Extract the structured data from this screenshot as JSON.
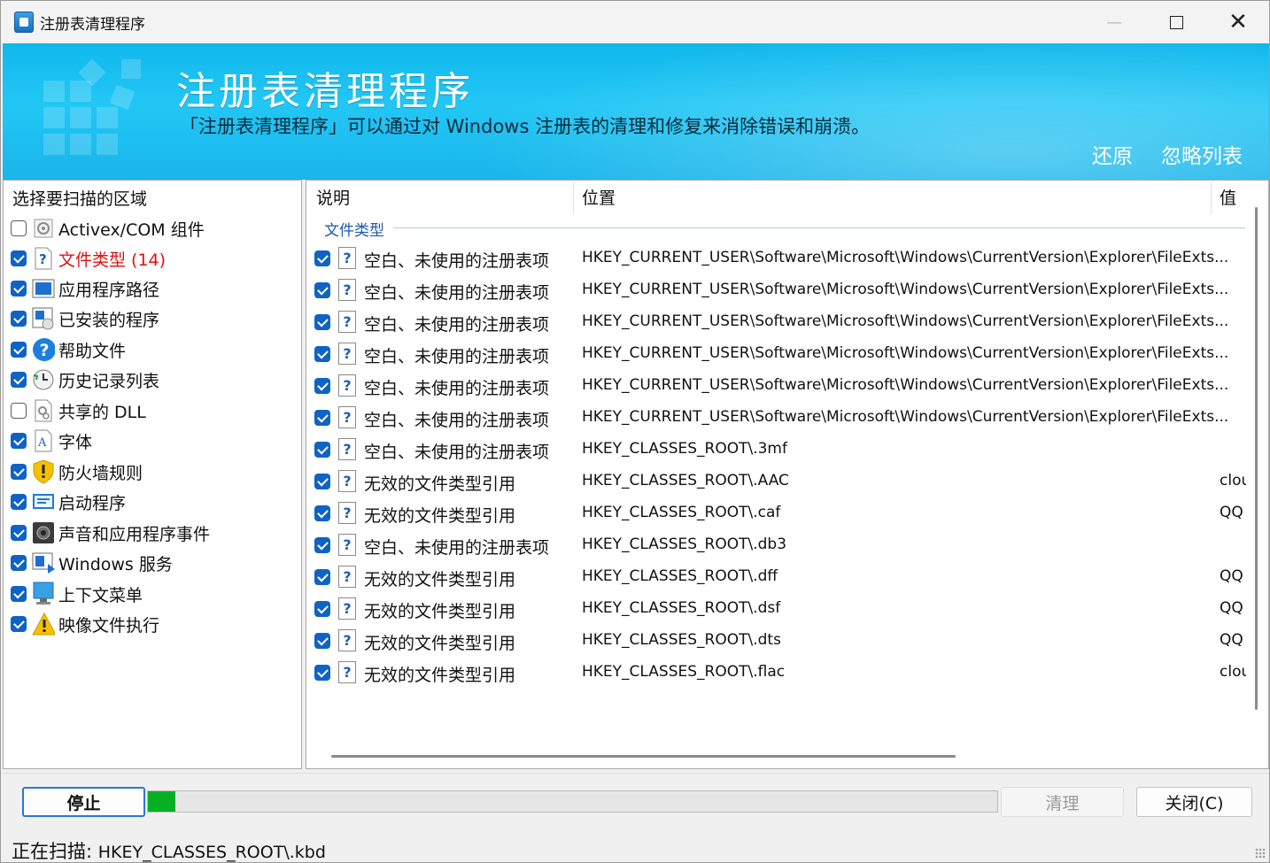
{
  "window": {
    "title": "注册表清理程序",
    "controls": {
      "minimize": "—",
      "maximize": "",
      "close": "✕"
    }
  },
  "banner": {
    "title": "注册表清理程序",
    "subtitle": "「注册表清理程序」可以通过对 Windows 注册表的清理和修复来消除错误和崩溃。",
    "links": [
      "还原",
      "忽略列表"
    ]
  },
  "sidebar": {
    "heading": "选择要扫描的区域",
    "items": [
      {
        "label": "Activex/COM 组件",
        "checked": false,
        "icon": "component-icon"
      },
      {
        "label": "文件类型 (14)",
        "checked": true,
        "icon": "file-type-icon",
        "highlight": true
      },
      {
        "label": "应用程序路径",
        "checked": true,
        "icon": "app-path-icon"
      },
      {
        "label": "已安装的程序",
        "checked": true,
        "icon": "installed-programs-icon"
      },
      {
        "label": "帮助文件",
        "checked": true,
        "icon": "help-icon"
      },
      {
        "label": "历史记录列表",
        "checked": true,
        "icon": "history-icon"
      },
      {
        "label": "共享的 DLL",
        "checked": false,
        "icon": "dll-icon"
      },
      {
        "label": "字体",
        "checked": true,
        "icon": "font-icon"
      },
      {
        "label": "防火墙规则",
        "checked": true,
        "icon": "firewall-icon"
      },
      {
        "label": "启动程序",
        "checked": true,
        "icon": "startup-icon"
      },
      {
        "label": "声音和应用程序事件",
        "checked": true,
        "icon": "sound-icon"
      },
      {
        "label": "Windows 服务",
        "checked": true,
        "icon": "services-icon"
      },
      {
        "label": "上下文菜单",
        "checked": true,
        "icon": "context-menu-icon"
      },
      {
        "label": "映像文件执行",
        "checked": true,
        "icon": "warning-icon"
      }
    ]
  },
  "results": {
    "columns": [
      "说明",
      "位置",
      "值"
    ],
    "group": "文件类型",
    "rows": [
      {
        "desc": "空白、未使用的注册表项",
        "loc": "HKEY_CURRENT_USER\\Software\\Microsoft\\Windows\\CurrentVersion\\Explorer\\FileExts...",
        "val": ""
      },
      {
        "desc": "空白、未使用的注册表项",
        "loc": "HKEY_CURRENT_USER\\Software\\Microsoft\\Windows\\CurrentVersion\\Explorer\\FileExts...",
        "val": ""
      },
      {
        "desc": "空白、未使用的注册表项",
        "loc": "HKEY_CURRENT_USER\\Software\\Microsoft\\Windows\\CurrentVersion\\Explorer\\FileExts...",
        "val": ""
      },
      {
        "desc": "空白、未使用的注册表项",
        "loc": "HKEY_CURRENT_USER\\Software\\Microsoft\\Windows\\CurrentVersion\\Explorer\\FileExts...",
        "val": ""
      },
      {
        "desc": "空白、未使用的注册表项",
        "loc": "HKEY_CURRENT_USER\\Software\\Microsoft\\Windows\\CurrentVersion\\Explorer\\FileExts...",
        "val": ""
      },
      {
        "desc": "空白、未使用的注册表项",
        "loc": "HKEY_CURRENT_USER\\Software\\Microsoft\\Windows\\CurrentVersion\\Explorer\\FileExts...",
        "val": ""
      },
      {
        "desc": "空白、未使用的注册表项",
        "loc": "HKEY_CLASSES_ROOT\\.3mf",
        "val": ""
      },
      {
        "desc": "无效的文件类型引用",
        "loc": "HKEY_CLASSES_ROOT\\.AAC",
        "val": "clou"
      },
      {
        "desc": "无效的文件类型引用",
        "loc": "HKEY_CLASSES_ROOT\\.caf",
        "val": "QQ"
      },
      {
        "desc": "空白、未使用的注册表项",
        "loc": "HKEY_CLASSES_ROOT\\.db3",
        "val": ""
      },
      {
        "desc": "无效的文件类型引用",
        "loc": "HKEY_CLASSES_ROOT\\.dff",
        "val": "QQ"
      },
      {
        "desc": "无效的文件类型引用",
        "loc": "HKEY_CLASSES_ROOT\\.dsf",
        "val": "QQ"
      },
      {
        "desc": "无效的文件类型引用",
        "loc": "HKEY_CLASSES_ROOT\\.dts",
        "val": "QQ"
      },
      {
        "desc": "无效的文件类型引用",
        "loc": "HKEY_CLASSES_ROOT\\.flac",
        "val": "clou"
      }
    ]
  },
  "footer": {
    "stop_label": "停止",
    "progress": 0.032,
    "clean_label": "清理",
    "close_label": "关闭(C)"
  },
  "status": {
    "prefix": "正在扫描:",
    "path": "HKEY_CLASSES_ROOT\\.kbd"
  },
  "colors": {
    "banner": "#1ec0f2",
    "highlight": "#e01010",
    "accent": "#0f63c4",
    "progress": "#06b025"
  }
}
